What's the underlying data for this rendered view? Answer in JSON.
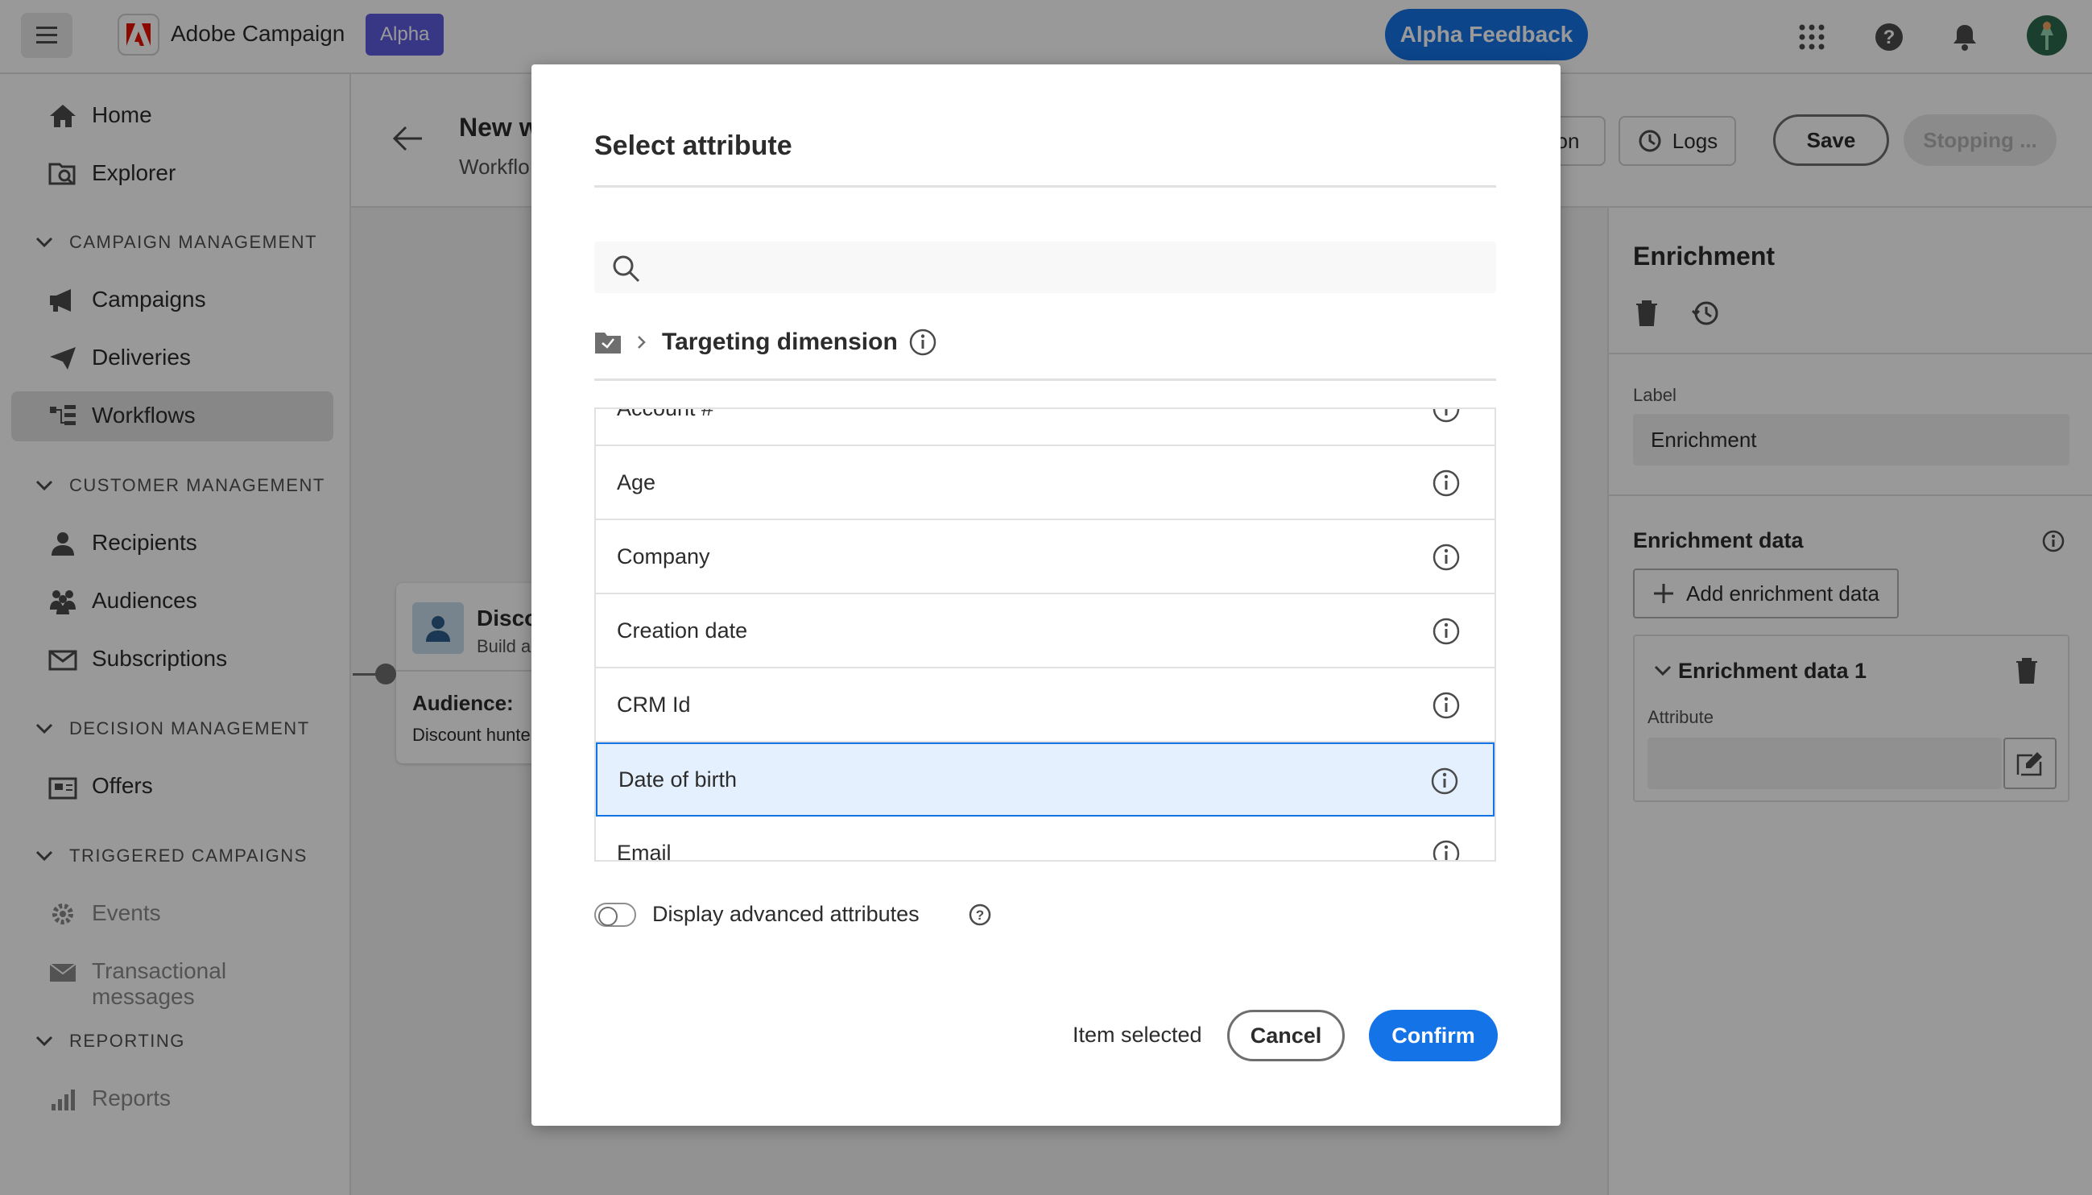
{
  "topbar": {
    "app_name": "Adobe Campaign",
    "env_badge": "Alpha",
    "feedback_label": "Alpha Feedback"
  },
  "sidebar": {
    "items": [
      {
        "label": "Home"
      },
      {
        "label": "Explorer"
      }
    ],
    "sections": [
      {
        "title": "CAMPAIGN MANAGEMENT",
        "items": [
          "Campaigns",
          "Deliveries",
          "Workflows"
        ]
      },
      {
        "title": "CUSTOMER MANAGEMENT",
        "items": [
          "Recipients",
          "Audiences",
          "Subscriptions"
        ]
      },
      {
        "title": "DECISION MANAGEMENT",
        "items": [
          "Offers"
        ]
      },
      {
        "title": "TRIGGERED CAMPAIGNS",
        "items": [
          "Events",
          "Transactional messages"
        ]
      },
      {
        "title": "REPORTING",
        "items": [
          "Reports"
        ]
      }
    ],
    "active_item": "Workflows"
  },
  "header": {
    "title": "New w",
    "subtitle": "Workflo",
    "partial_button": "on",
    "logs_label": "Logs",
    "save_label": "Save",
    "stopping_label": "Stopping ..."
  },
  "canvas": {
    "node_title": "Disco",
    "node_sub": "Build a",
    "audience_label": "Audience:",
    "audience_value": "Discount hunte"
  },
  "right_panel": {
    "title": "Enrichment",
    "label_caption": "Label",
    "label_value": "Enrichment",
    "section_title": "Enrichment data",
    "add_label": "Add enrichment data",
    "group_title": "Enrichment data 1",
    "attribute_caption": "Attribute",
    "attribute_value": ""
  },
  "modal": {
    "title": "Select attribute",
    "search_placeholder": "",
    "breadcrumb_title": "Targeting dimension",
    "attributes": [
      "Account #",
      "Age",
      "Company",
      "Creation date",
      "CRM Id",
      "Date of birth",
      "Email"
    ],
    "selected": "Date of birth",
    "toggle_label": "Display advanced attributes",
    "toggle_on": false,
    "status_text": "Item selected",
    "cancel_label": "Cancel",
    "confirm_label": "Confirm"
  },
  "colors": {
    "accent": "#1473e6",
    "badge": "#5c5ce0",
    "selected_row_bg": "#e5f0fe"
  }
}
